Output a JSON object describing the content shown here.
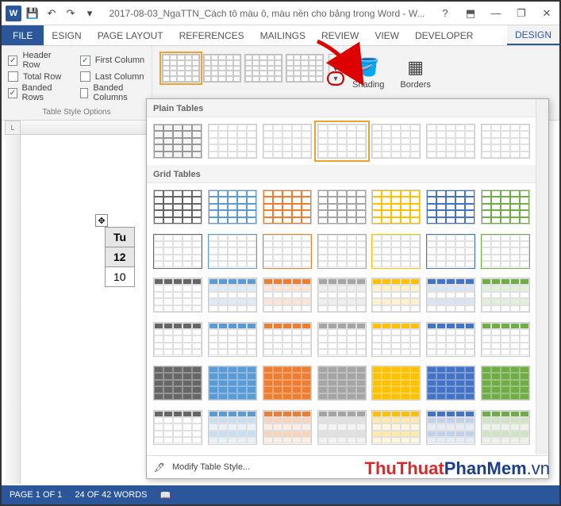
{
  "titlebar": {
    "doc_title": "2017-08-03_NgaTTN_Cách tô màu ô, màu nền cho bảng trong Word - W...",
    "qat": {
      "save": "💾",
      "undo": "↶",
      "redo": "↷",
      "customize": "▾"
    }
  },
  "win_controls": {
    "help": "?",
    "ribbon_opts": "⬒",
    "min": "—",
    "max": "❐",
    "close": "✕"
  },
  "tabs": {
    "file": "FILE",
    "items": [
      "ESIGN",
      "PAGE LAYOUT",
      "REFERENCES",
      "MAILINGS",
      "REVIEW",
      "VIEW",
      "DEVELOPER"
    ],
    "contextual": "DESIGN"
  },
  "ribbon": {
    "style_options": {
      "header_row": "Header Row",
      "total_row": "Total Row",
      "banded_rows": "Banded Rows",
      "first_col": "First Column",
      "last_col": "Last Column",
      "banded_cols": "Banded Columns",
      "group_label": "Table Style Options"
    },
    "shading_label": "Shading",
    "borders_label": "Borders"
  },
  "dropdown": {
    "plain_label": "Plain Tables",
    "grid_label": "Grid Tables",
    "modify_label": "Modify Table Style...",
    "grid_colors": [
      "#666",
      "#5b9bd5",
      "#ed7d31",
      "#a5a5a5",
      "#ffc000",
      "#4472c4",
      "#70ad47"
    ]
  },
  "document": {
    "row0": "Tu",
    "row1": "12",
    "row2": "10"
  },
  "statusbar": {
    "page": "PAGE 1 OF 1",
    "words": "24 OF 42 WORDS"
  },
  "ruler_corner": "L",
  "watermark": {
    "a": "ThuThuat",
    "b": "PhanMem",
    "c": ".vn"
  }
}
